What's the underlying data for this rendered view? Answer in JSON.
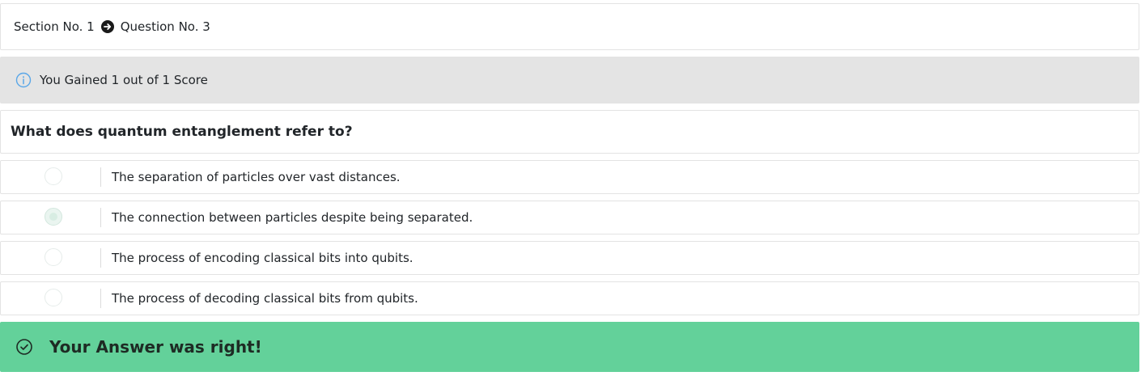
{
  "breadcrumb": {
    "section": "Section No. 1",
    "question": "Question No. 3",
    "arrow_icon": "arrow-circle-right-icon"
  },
  "score_alert": {
    "icon": "info-circle-icon",
    "text": "You Gained 1 out of 1 Score",
    "icon_color": "#5aa7e8",
    "background": "#e4e4e4"
  },
  "question": {
    "text": "What does quantum entanglement refer to?"
  },
  "options": [
    {
      "label": "The separation of particles over vast distances.",
      "selected": false
    },
    {
      "label": "The connection between particles despite being separated.",
      "selected": true
    },
    {
      "label": "The process of encoding classical bits into qubits.",
      "selected": false
    },
    {
      "label": "The process of decoding classical bits from qubits.",
      "selected": false
    }
  ],
  "result": {
    "icon": "check-circle-icon",
    "text": "Your Answer was right!",
    "background": "#63d19a"
  }
}
